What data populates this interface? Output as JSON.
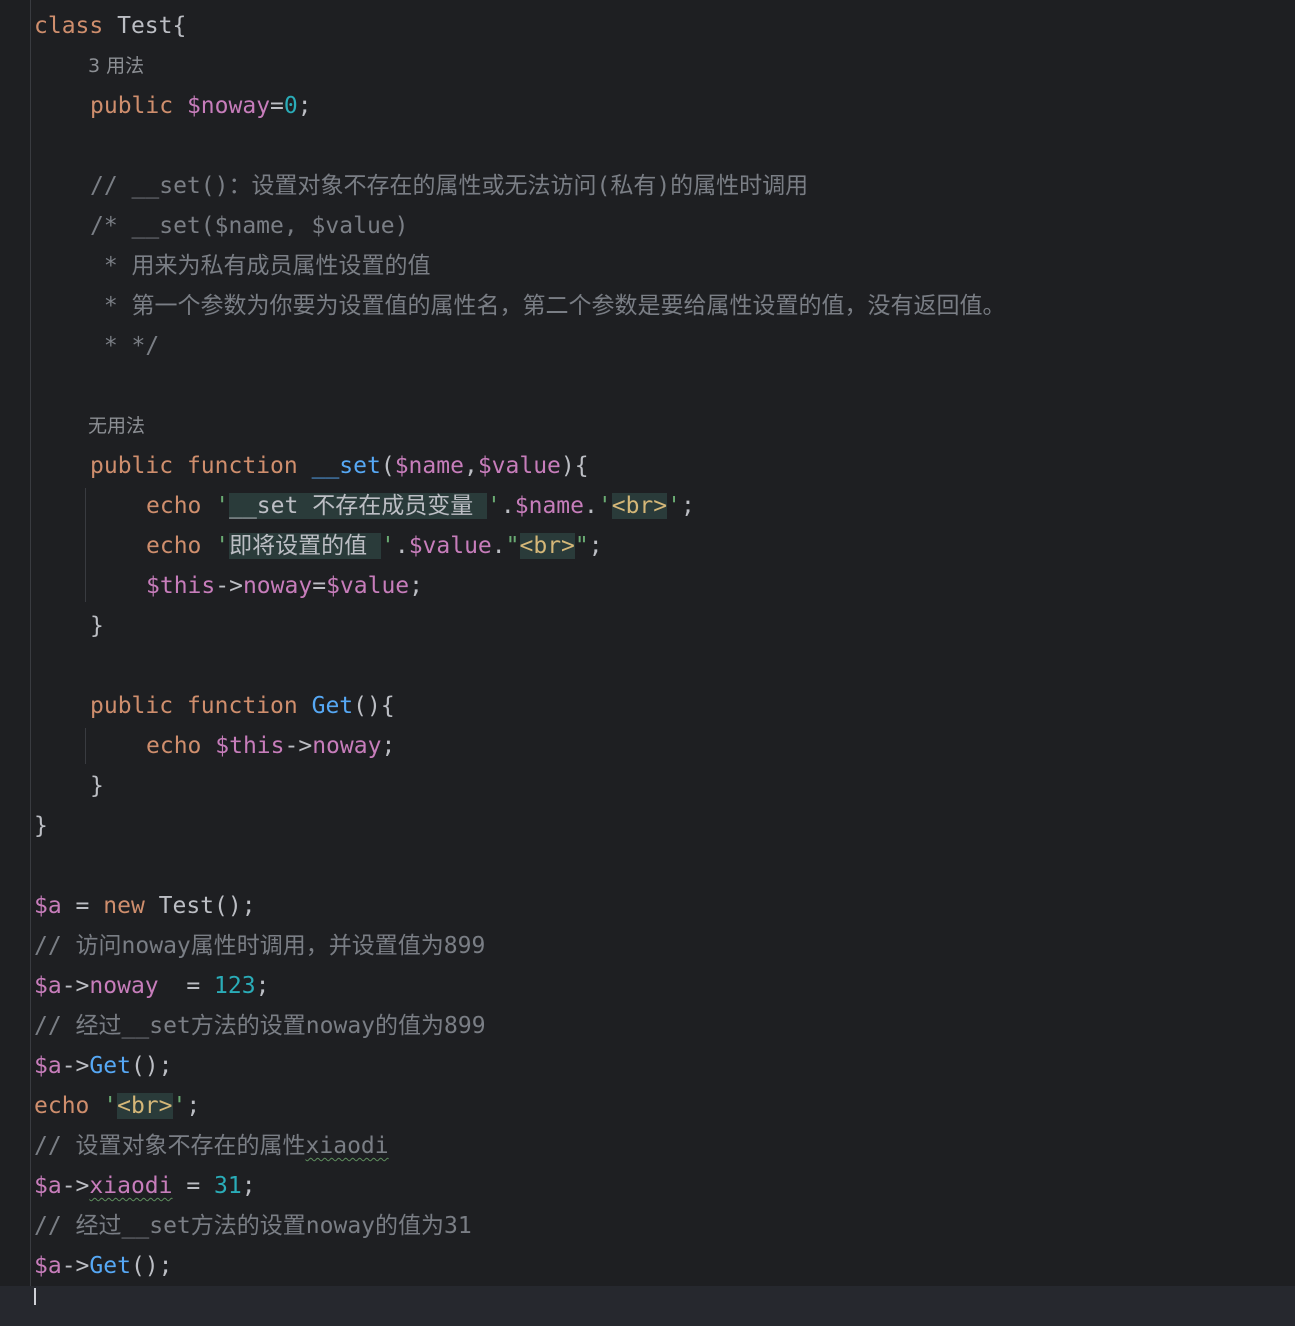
{
  "code": {
    "l1": {
      "kw": "class",
      "name": "Test{"
    },
    "hint1": "3 用法",
    "l2": {
      "kw": "public",
      "var": "$noway",
      "eq": "=",
      "num": "0",
      "end": ";"
    },
    "l3": "// __set()：设置对象不存在的属性或无法访问(私有)的属性时调用",
    "l4": "/* __set($name, $value)",
    "l5": " * 用来为私有成员属性设置的值",
    "l6": " * 第一个参数为你要为设置值的属性名，第二个参数是要给属性设置的值，没有返回值。",
    "l7": " * */",
    "hint2": "无用法",
    "l8": {
      "kw1": "public",
      "kw2": "function",
      "fn": "__set",
      "open": "(",
      "p1": "$name",
      "comma": ",",
      "p2": "$value",
      "close": "){"
    },
    "l9": {
      "kw": "echo",
      "q1": "'",
      "inj": "__set 不存在成员变量 ",
      "q2": "'",
      "dot1": ".",
      "var": "$name",
      "dot2": ".",
      "q3": "'",
      "br": "<br>",
      "q4": "'",
      "end": ";"
    },
    "l10": {
      "kw": "echo",
      "q1": "'",
      "inj": "即将设置的值 ",
      "q2": "'",
      "dot1": ".",
      "var": "$value",
      "dot2": ".",
      "q3": "\"",
      "br": "<br>",
      "q4": "\"",
      "end": ";"
    },
    "l11": {
      "var1": "$this",
      "arrow": "->",
      "prop": "noway",
      "eq": "=",
      "var2": "$value",
      "end": ";"
    },
    "l12": "}",
    "l13": {
      "kw1": "public",
      "kw2": "function",
      "fn": "Get",
      "rest": "(){"
    },
    "l14": {
      "kw": "echo",
      "var": "$this",
      "arrow": "->",
      "prop": "noway",
      "end": ";"
    },
    "l15": "}",
    "l16": "}",
    "l17": {
      "var": "$a",
      "eq": " = ",
      "kw": "new",
      "rest": " Test();"
    },
    "l18": "// 访问noway属性时调用，并设置值为899",
    "l19": {
      "var": "$a",
      "arrow": "->",
      "prop": "noway",
      "eq": "  = ",
      "num": "123",
      "end": ";"
    },
    "l20": "// 经过__set方法的设置noway的值为899",
    "l21": {
      "var": "$a",
      "arrow": "->",
      "fn": "Get",
      "rest": "();"
    },
    "l22": {
      "kw": "echo",
      "q1": "'",
      "br": "<br>",
      "q2": "'",
      "end": ";"
    },
    "l23": {
      "pre": "// 设置对象不存在的属性",
      "typo": "xiaodi"
    },
    "l24": {
      "var": "$a",
      "arrow": "->",
      "prop": "xiaodi",
      "eq": " = ",
      "num": "31",
      "end": ";"
    },
    "l25": "// 经过__set方法的设置noway的值为31",
    "l26": {
      "var": "$a",
      "arrow": "->",
      "fn": "Get",
      "rest": "();"
    }
  }
}
